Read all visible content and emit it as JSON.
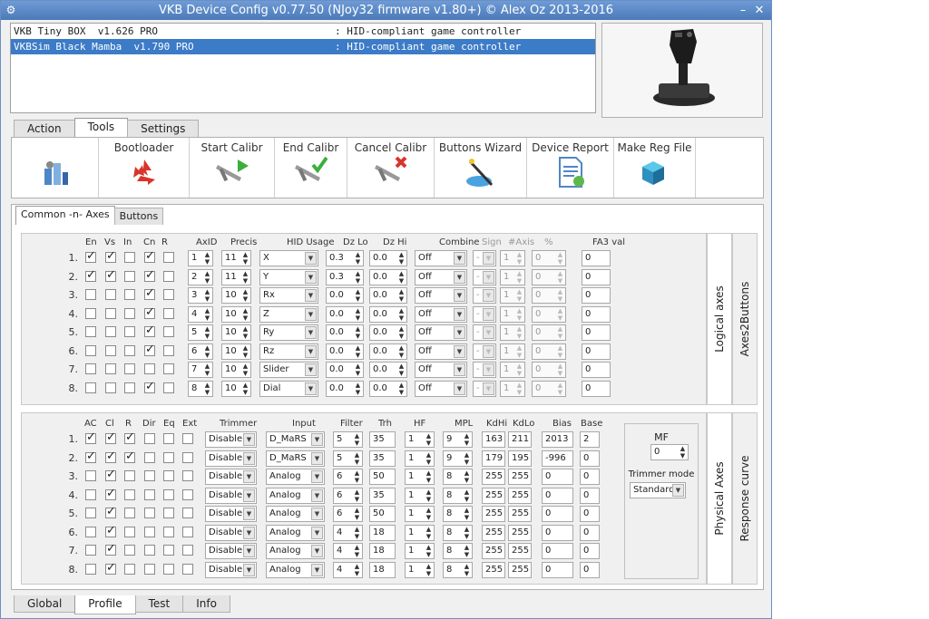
{
  "window": {
    "title": "VKB Device Config v0.77.50 (NJoy32 firmware v1.80+) © Alex Oz 2013-2016",
    "min_label": "–",
    "close_label": "✕"
  },
  "devices": [
    {
      "name": "VKB Tiny BOX  v1.626 PRO",
      "type": ": HID-compliant game controller",
      "selected": false
    },
    {
      "name": "VKBSim Black Mamba  v1.790 PRO",
      "type": ": HID-compliant game controller",
      "selected": true
    }
  ],
  "main_tabs": [
    "Action",
    "Tools",
    "Settings"
  ],
  "active_main_tab": "Tools",
  "tools": [
    {
      "label": "",
      "icon": "config-icon"
    },
    {
      "label": "Bootloader",
      "icon": "recycle-icon"
    },
    {
      "label": "Start Calibr",
      "icon": "caliper-play-icon"
    },
    {
      "label": "End Calibr",
      "icon": "caliper-check-icon"
    },
    {
      "label": "Cancel Calibr",
      "icon": "caliper-cancel-icon"
    },
    {
      "label": "Buttons Wizard",
      "icon": "wizard-icon"
    },
    {
      "label": "Device Report",
      "icon": "report-icon"
    },
    {
      "label": "Make Reg File",
      "icon": "registry-icon"
    }
  ],
  "sub_tabs": [
    "Common -n- Axes",
    "Buttons"
  ],
  "logical": {
    "side_tabs": [
      "Logical axes",
      "Axes2Buttons"
    ],
    "headers": {
      "en": "En",
      "vs": "Vs",
      "in": "In",
      "cn": "Cn",
      "r": "R",
      "axid": "AxID",
      "precis": "Precis",
      "hid": "HID Usage",
      "dzlo": "Dz Lo",
      "dzhi": "Dz Hi",
      "combine": "Combine",
      "sign": "Sign",
      "naxis": "#Axis",
      "pct": "%",
      "fa3": "FA3 val"
    },
    "rows": [
      {
        "n": "1.",
        "en": true,
        "vs": true,
        "in": false,
        "cn": true,
        "r": false,
        "axid": "1",
        "precis": "11",
        "hid": "X",
        "dzlo": "0.3",
        "dzhi": "0.0",
        "combine": "Off",
        "sign": "-",
        "naxis": "1",
        "pct": "0",
        "fa3": "0"
      },
      {
        "n": "2.",
        "en": true,
        "vs": true,
        "in": false,
        "cn": true,
        "r": false,
        "axid": "2",
        "precis": "11",
        "hid": "Y",
        "dzlo": "0.3",
        "dzhi": "0.0",
        "combine": "Off",
        "sign": "-",
        "naxis": "1",
        "pct": "0",
        "fa3": "0"
      },
      {
        "n": "3.",
        "en": false,
        "vs": false,
        "in": false,
        "cn": true,
        "r": false,
        "axid": "3",
        "precis": "10",
        "hid": "Rx",
        "dzlo": "0.0",
        "dzhi": "0.0",
        "combine": "Off",
        "sign": "-",
        "naxis": "1",
        "pct": "0",
        "fa3": "0"
      },
      {
        "n": "4.",
        "en": false,
        "vs": false,
        "in": false,
        "cn": true,
        "r": false,
        "axid": "4",
        "precis": "10",
        "hid": "Z",
        "dzlo": "0.0",
        "dzhi": "0.0",
        "combine": "Off",
        "sign": "-",
        "naxis": "1",
        "pct": "0",
        "fa3": "0"
      },
      {
        "n": "5.",
        "en": false,
        "vs": false,
        "in": false,
        "cn": true,
        "r": false,
        "axid": "5",
        "precis": "10",
        "hid": "Ry",
        "dzlo": "0.0",
        "dzhi": "0.0",
        "combine": "Off",
        "sign": "-",
        "naxis": "1",
        "pct": "0",
        "fa3": "0"
      },
      {
        "n": "6.",
        "en": false,
        "vs": false,
        "in": false,
        "cn": true,
        "r": false,
        "axid": "6",
        "precis": "10",
        "hid": "Rz",
        "dzlo": "0.0",
        "dzhi": "0.0",
        "combine": "Off",
        "sign": "-",
        "naxis": "1",
        "pct": "0",
        "fa3": "0"
      },
      {
        "n": "7.",
        "en": false,
        "vs": false,
        "in": false,
        "cn": false,
        "r": false,
        "axid": "7",
        "precis": "10",
        "hid": "Slider",
        "dzlo": "0.0",
        "dzhi": "0.0",
        "combine": "Off",
        "sign": "-",
        "naxis": "1",
        "pct": "0",
        "fa3": "0"
      },
      {
        "n": "8.",
        "en": false,
        "vs": false,
        "in": false,
        "cn": true,
        "r": false,
        "axid": "8",
        "precis": "10",
        "hid": "Dial",
        "dzlo": "0.0",
        "dzhi": "0.0",
        "combine": "Off",
        "sign": "-",
        "naxis": "1",
        "pct": "0",
        "fa3": "0"
      }
    ]
  },
  "physical": {
    "side_tabs": [
      "Physical Axes",
      "Response curve"
    ],
    "headers": {
      "ac": "AC",
      "cl": "Cl",
      "r": "R",
      "dir": "Dir",
      "eq": "Eq",
      "ext": "Ext",
      "trimmer": "Trimmer",
      "input": "Input",
      "filter": "Filter",
      "trh": "Trh",
      "hf": "HF",
      "mpl": "MPL",
      "kdhi": "KdHi",
      "kdlo": "KdLo",
      "bias": "Bias",
      "base": "Base"
    },
    "rows": [
      {
        "n": "1.",
        "ac": true,
        "cl": true,
        "r": true,
        "dir": false,
        "eq": false,
        "ext": false,
        "trimmer": "Disable",
        "input": "D_MaRS",
        "filter": "5",
        "trh": "35",
        "hf": "1",
        "mpl": "9",
        "kdhi": "163",
        "kdlo": "211",
        "bias": "2013",
        "base": "2"
      },
      {
        "n": "2.",
        "ac": true,
        "cl": true,
        "r": true,
        "dir": false,
        "eq": false,
        "ext": false,
        "trimmer": "Disable",
        "input": "D_MaRS",
        "filter": "5",
        "trh": "35",
        "hf": "1",
        "mpl": "9",
        "kdhi": "179",
        "kdlo": "195",
        "bias": "-996",
        "base": "0"
      },
      {
        "n": "3.",
        "ac": false,
        "cl": true,
        "r": false,
        "dir": false,
        "eq": false,
        "ext": false,
        "trimmer": "Disable",
        "input": "Analog",
        "filter": "6",
        "trh": "50",
        "hf": "1",
        "mpl": "8",
        "kdhi": "255",
        "kdlo": "255",
        "bias": "0",
        "base": "0"
      },
      {
        "n": "4.",
        "ac": false,
        "cl": true,
        "r": false,
        "dir": false,
        "eq": false,
        "ext": false,
        "trimmer": "Disable",
        "input": "Analog",
        "filter": "6",
        "trh": "35",
        "hf": "1",
        "mpl": "8",
        "kdhi": "255",
        "kdlo": "255",
        "bias": "0",
        "base": "0"
      },
      {
        "n": "5.",
        "ac": false,
        "cl": true,
        "r": false,
        "dir": false,
        "eq": false,
        "ext": false,
        "trimmer": "Disable",
        "input": "Analog",
        "filter": "6",
        "trh": "50",
        "hf": "1",
        "mpl": "8",
        "kdhi": "255",
        "kdlo": "255",
        "bias": "0",
        "base": "0"
      },
      {
        "n": "6.",
        "ac": false,
        "cl": true,
        "r": false,
        "dir": false,
        "eq": false,
        "ext": false,
        "trimmer": "Disable",
        "input": "Analog",
        "filter": "4",
        "trh": "18",
        "hf": "1",
        "mpl": "8",
        "kdhi": "255",
        "kdlo": "255",
        "bias": "0",
        "base": "0"
      },
      {
        "n": "7.",
        "ac": false,
        "cl": true,
        "r": false,
        "dir": false,
        "eq": false,
        "ext": false,
        "trimmer": "Disable",
        "input": "Analog",
        "filter": "4",
        "trh": "18",
        "hf": "1",
        "mpl": "8",
        "kdhi": "255",
        "kdlo": "255",
        "bias": "0",
        "base": "0"
      },
      {
        "n": "8.",
        "ac": false,
        "cl": true,
        "r": false,
        "dir": false,
        "eq": false,
        "ext": false,
        "trimmer": "Disable",
        "input": "Analog",
        "filter": "4",
        "trh": "18",
        "hf": "1",
        "mpl": "8",
        "kdhi": "255",
        "kdlo": "255",
        "bias": "0",
        "base": "0"
      }
    ],
    "mf_label": "MF",
    "mf_value": "0",
    "trimmer_mode_label": "Trimmer mode",
    "trimmer_mode_value": "Standard"
  },
  "bottom_tabs": [
    "Global",
    "Profile",
    "Test",
    "Info"
  ],
  "active_bottom_tab": "Profile",
  "colors": {
    "selection": "#3c7bc7",
    "title_bar": "#5a88c6"
  }
}
